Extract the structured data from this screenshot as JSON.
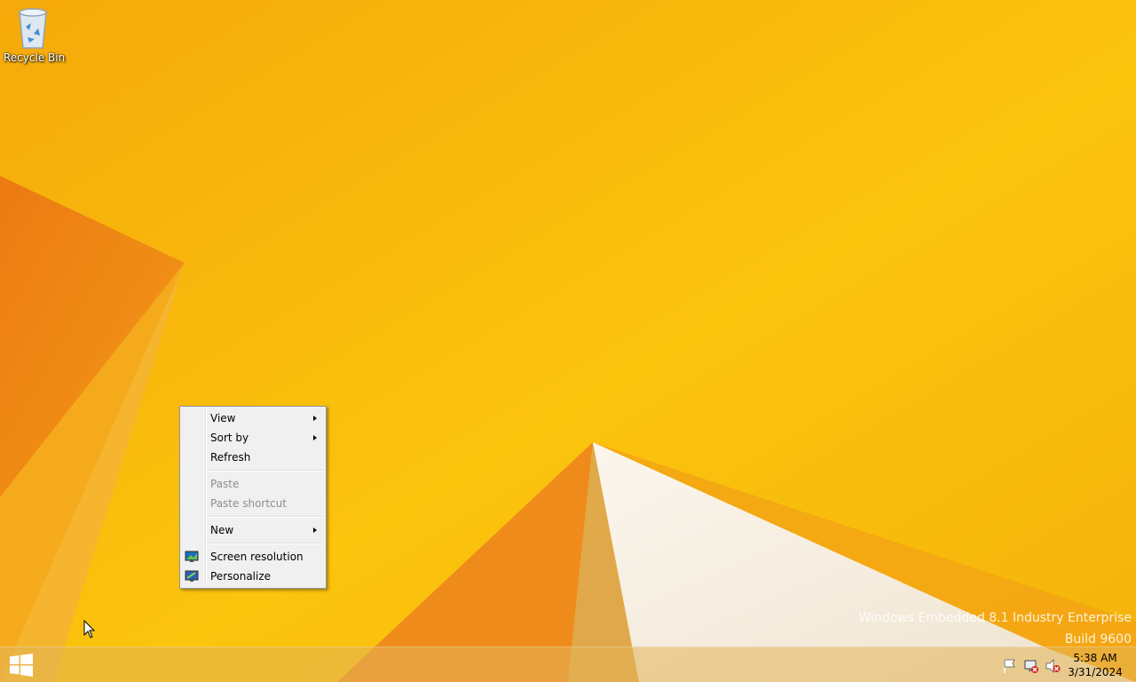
{
  "desktop": {
    "icons": [
      {
        "label": "Recycle Bin",
        "icon": "recycle-bin-icon"
      }
    ],
    "colors": {
      "wallpaper_base": "#f6b40c",
      "wallpaper_shade": "#ef8a12",
      "wallpaper_light": "#f7efe2"
    }
  },
  "context_menu": {
    "items": [
      {
        "label": "View",
        "submenu": true,
        "enabled": true
      },
      {
        "label": "Sort by",
        "submenu": true,
        "enabled": true
      },
      {
        "label": "Refresh",
        "enabled": true
      },
      {
        "label": "Paste",
        "enabled": false
      },
      {
        "label": "Paste shortcut",
        "enabled": false
      },
      {
        "label": "New",
        "submenu": true,
        "enabled": true
      },
      {
        "label": "Screen resolution",
        "icon": "screen-resolution-icon",
        "enabled": true
      },
      {
        "label": "Personalize",
        "icon": "personalize-icon",
        "enabled": true
      }
    ]
  },
  "watermark": {
    "line1": "Windows Embedded 8.1 Industry Enterprise",
    "line2": "Build 9600"
  },
  "taskbar": {
    "start_icon": "windows-logo-icon",
    "tray_icons": [
      "action-center-flag-icon",
      "network-disconnected-icon",
      "volume-muted-icon"
    ],
    "clock": {
      "time": "5:38 AM",
      "date": "3/31/2024"
    }
  }
}
